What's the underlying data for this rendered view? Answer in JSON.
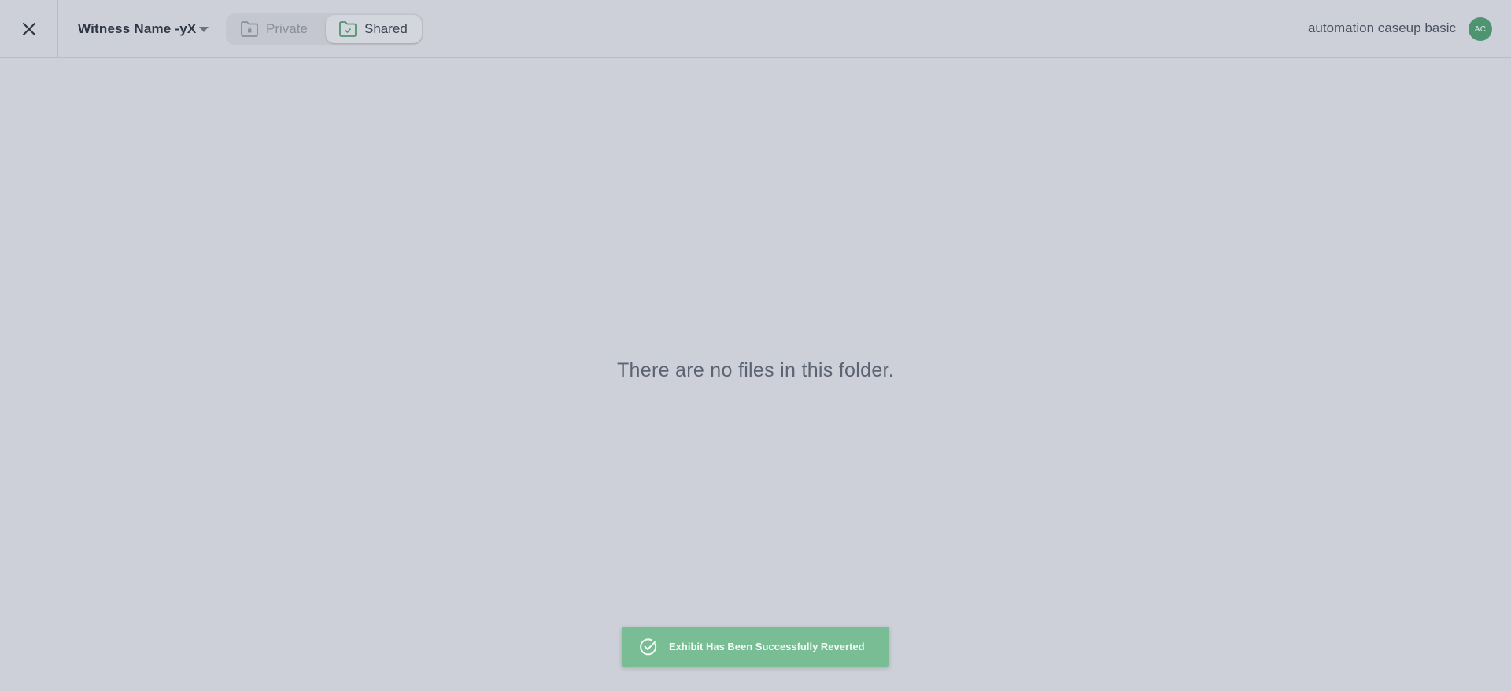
{
  "header": {
    "close_icon": "close-icon",
    "witness_name": "Witness Name -yX",
    "dropdown_icon": "caret-down-icon",
    "folder_tabs": [
      {
        "label": "Private",
        "icon": "folder-lock-icon",
        "active": false
      },
      {
        "label": "Shared",
        "icon": "folder-check-icon",
        "active": true
      }
    ],
    "user_name": "automation caseup basic",
    "avatar_initials": "AC"
  },
  "main": {
    "empty_message": "There are no files in this folder."
  },
  "toast": {
    "icon": "check-circle-icon",
    "message": "Exhibit Has Been Successfully Reverted"
  },
  "colors": {
    "background": "#cdd0d8",
    "accent_green": "#4f9470",
    "toast_green": "#79bd94",
    "text_dark": "#2f3645"
  }
}
